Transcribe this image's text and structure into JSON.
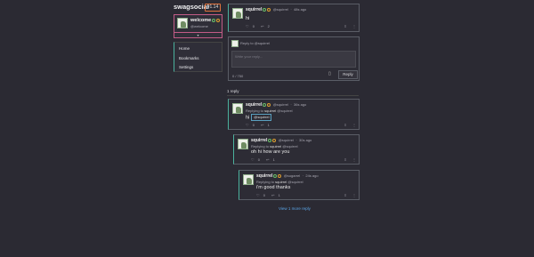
{
  "app": {
    "brand": "swagsocial",
    "version": "v1.14"
  },
  "profile": {
    "name": "welcome",
    "handle": "@welcome",
    "bar_glyph": "▾"
  },
  "nav": [
    {
      "label": "Home"
    },
    {
      "label": "Bookmarks"
    },
    {
      "label": "Settings"
    }
  ],
  "colors": {
    "accent_teal": "#4ab19d",
    "accent_pink": "#c25b86",
    "link_blue": "#5aa6e8",
    "version_border": "#e0733d"
  },
  "main_post": {
    "name": "squirrel",
    "handle": "@squirrel",
    "time": "48s ago",
    "body": "hi",
    "likes": "0",
    "replies": "2"
  },
  "reply_box": {
    "label": "Reply to @squirrel",
    "placeholder": "Write your reply...",
    "count": "0 / 750",
    "button": "Reply"
  },
  "replies_count_label": "1 reply",
  "replies": [
    {
      "name": "squirrel",
      "handle": "@squirrel",
      "time": "36s ago",
      "replying_prefix": "Replying to",
      "replying_to": "squirrel",
      "replying_handle": "@squirrel",
      "body": "hi",
      "mention": "@squirrel",
      "likes": "0",
      "replies": "1"
    },
    {
      "name": "squirrel",
      "handle": "@squirrel",
      "time": "30s ago",
      "replying_prefix": "Replying to",
      "replying_to": "squirrel",
      "replying_handle": "@squirrel",
      "body": "oh hi how are you",
      "likes": "0",
      "replies": "1"
    },
    {
      "name": "squirrel",
      "handle": "@sugarrel",
      "time": "24s ago",
      "replying_prefix": "Replying to",
      "replying_to": "squirrel",
      "replying_handle": "@squirrel",
      "body": "i'm good thanks",
      "likes": "0",
      "replies": "1"
    }
  ],
  "view_more": "View 1 more reply",
  "icons": {
    "like": "heart-icon",
    "reply": "reply-icon",
    "bookmark": "bookmark-icon",
    "more": "more-icon",
    "attach": "file-icon"
  }
}
